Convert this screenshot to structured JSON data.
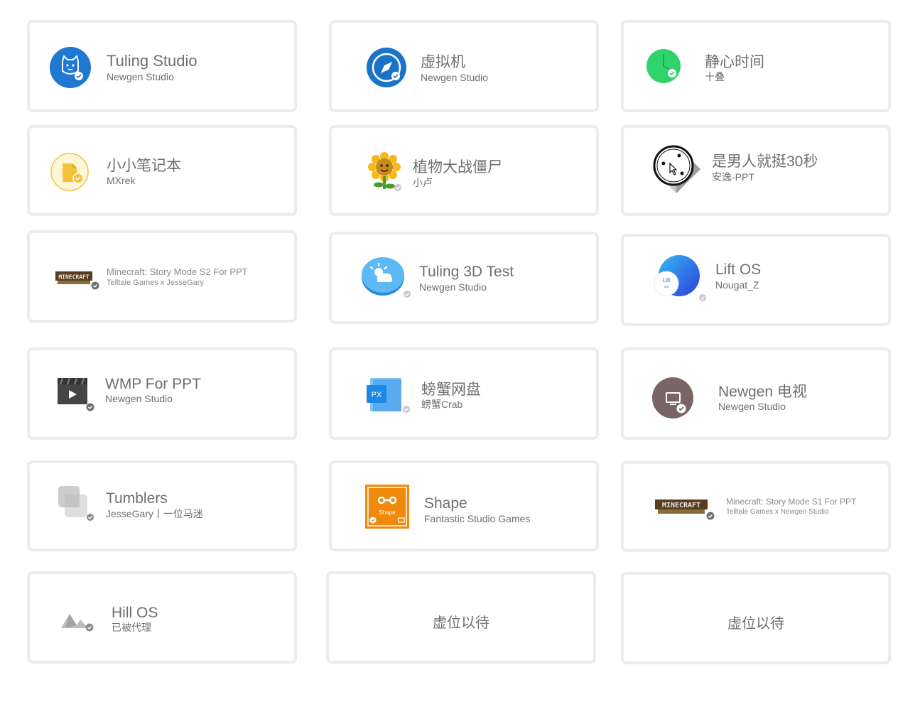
{
  "apps": [
    {
      "title": "Tuling Studio",
      "subtitle": "Newgen Studio",
      "icon": "cat-icon",
      "color": "#1f78d1"
    },
    {
      "title": "虚拟机",
      "subtitle": "Newgen Studio",
      "icon": "compass-icon",
      "color": "#1a73c8"
    },
    {
      "title": "静心时间",
      "subtitle": "十叠",
      "icon": "clock-icon",
      "color": "#2fd36a"
    },
    {
      "title": "小小笔记本",
      "subtitle": "MXrek",
      "icon": "notebook-icon",
      "color": "#f6c13a"
    },
    {
      "title": "植物大战僵尸",
      "subtitle": "小卢",
      "icon": "sunflower-icon",
      "color": "#f5b81a"
    },
    {
      "title": "是男人就挺30秒",
      "subtitle": "安逸-PPT",
      "icon": "target-icon",
      "color": "#222222"
    },
    {
      "title": "Minecraft: Story Mode S2 For PPT",
      "subtitle": "Telltale Games x JesseGary",
      "icon": "minecraft-logo-icon",
      "color": "#5a3d1e"
    },
    {
      "title": "Tuling 3D Test",
      "subtitle": "Newgen Studio",
      "icon": "weather-icon",
      "color": "#3ea6f0"
    },
    {
      "title": "Lift OS",
      "subtitle": "Nougat_Z",
      "icon": "lift-os-icon",
      "color": "#1e6fe0"
    },
    {
      "title": "WMP For PPT",
      "subtitle": "Newgen Studio",
      "icon": "clapperboard-icon",
      "color": "#444444"
    },
    {
      "title": "螃蟹网盘",
      "subtitle": "螃蟹Crab",
      "icon": "cloud-disk-icon",
      "color": "#1e88e5"
    },
    {
      "title": "Newgen 电视",
      "subtitle": "Newgen Studio",
      "icon": "tv-icon",
      "color": "#786564"
    },
    {
      "title": "Tumblers",
      "subtitle": "JesseGary丨一位马迷",
      "icon": "tumblers-icon",
      "color": "#cfcfcf"
    },
    {
      "title": "Shape",
      "subtitle": "Fantastic Studio Games",
      "icon": "shape-icon",
      "color": "#ef8a0c",
      "icon_label": "Shape"
    },
    {
      "title": "Minecraft: Story Mode S1 For PPT",
      "subtitle": "Telltale Games x Newgen Studio",
      "icon": "minecraft-logo-icon",
      "color": "#5a3d1e"
    },
    {
      "title": "Hill OS",
      "subtitle": "已被代理",
      "icon": "mountain-icon",
      "color": "#bdbdbd"
    }
  ],
  "placeholders": [
    {
      "label": "虚位以待"
    },
    {
      "label": "虚位以待"
    }
  ],
  "icon_labels": {
    "lift": "Lift",
    "os": "OS",
    "px": "PX",
    "minecraft": "MINECRAFT"
  }
}
